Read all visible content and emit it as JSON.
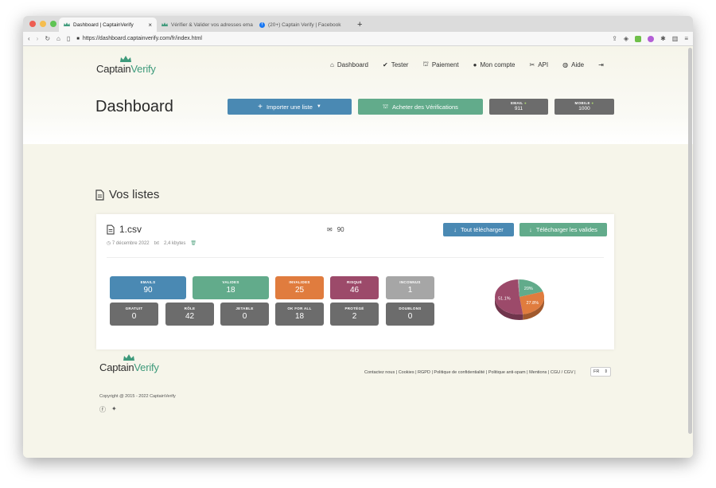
{
  "browser": {
    "tabs": [
      {
        "title": "Dashboard | CaptainVerify",
        "active": true
      },
      {
        "title": "Vérifier & Valider vos adresses ema",
        "active": false
      },
      {
        "title": "(20+) Captain Verify | Facebook",
        "active": false
      }
    ],
    "url": "https://dashboard.captainverify.com/fr/index.html"
  },
  "brand": {
    "word_a": "Captain",
    "word_b": "Verify",
    "accent": "#3e9a7b"
  },
  "nav": [
    {
      "label": "Dashboard",
      "icon": "home-icon",
      "glyph": "⌂"
    },
    {
      "label": "Tester",
      "icon": "check-circle-icon",
      "glyph": "✔"
    },
    {
      "label": "Paiement",
      "icon": "basket-icon",
      "glyph": "⛫"
    },
    {
      "label": "Mon compte",
      "icon": "user-icon",
      "glyph": "●"
    },
    {
      "label": "API",
      "icon": "tools-icon",
      "glyph": "✂"
    },
    {
      "label": "Aide",
      "icon": "globe-icon",
      "glyph": "◍"
    },
    {
      "label": "",
      "icon": "logout-icon",
      "glyph": "⇥"
    }
  ],
  "page_title": "Dashboard",
  "actions": {
    "import_label": "Importer une liste",
    "buy_label": "Acheter des Vérifications",
    "email_label": "EMAIL",
    "email_value": "911",
    "mobile_label": "MOBILE",
    "mobile_value": "1000"
  },
  "section_title": "Vos listes",
  "list": {
    "name": "1.csv",
    "date": "7 décembre 2022",
    "type": "txt",
    "size": "2,4 kbytes",
    "email_count": "90",
    "download_all": "Tout télécharger",
    "download_valid": "Télécharger les valides"
  },
  "stats_top": [
    {
      "label": "EMAILS",
      "value": "90",
      "color": "#4a89b3"
    },
    {
      "label": "VALIDES",
      "value": "18",
      "color": "#62ab8b"
    },
    {
      "label": "INVALIDES",
      "value": "25",
      "color": "#e07c3e"
    },
    {
      "label": "RISQUÉ",
      "value": "46",
      "color": "#9c4a6a"
    },
    {
      "label": "INCONNUS",
      "value": "1",
      "color": "#a6a6a6"
    }
  ],
  "stats_bottom": [
    {
      "label": "GRATUIT",
      "value": "0"
    },
    {
      "label": "RÔLE",
      "value": "42"
    },
    {
      "label": "JETABLE",
      "value": "0"
    },
    {
      "label": "OK FOR ALL",
      "value": "18"
    },
    {
      "label": "PROTÉGÉ",
      "value": "2"
    },
    {
      "label": "DOUBLONS",
      "value": "0"
    }
  ],
  "chart_data": {
    "type": "pie",
    "slices": [
      {
        "label": "20%",
        "value": 20,
        "color": "#62ab8b"
      },
      {
        "label": "27.8%",
        "value": 27.8,
        "color": "#e07c3e"
      },
      {
        "label": "51.1%",
        "value": 51.1,
        "color": "#9c4a6a"
      },
      {
        "label": "",
        "value": 1.1,
        "color": "#a6a6a6"
      }
    ]
  },
  "footer": {
    "links": "Contactez nous | Cookies | RGPD | Politique de confidentialité | Politique anti-spam | Mentions | CGU / CGV |",
    "lang": "FR",
    "copyright": "Copyright @ 2015 - 2022 CaptainVerify"
  }
}
